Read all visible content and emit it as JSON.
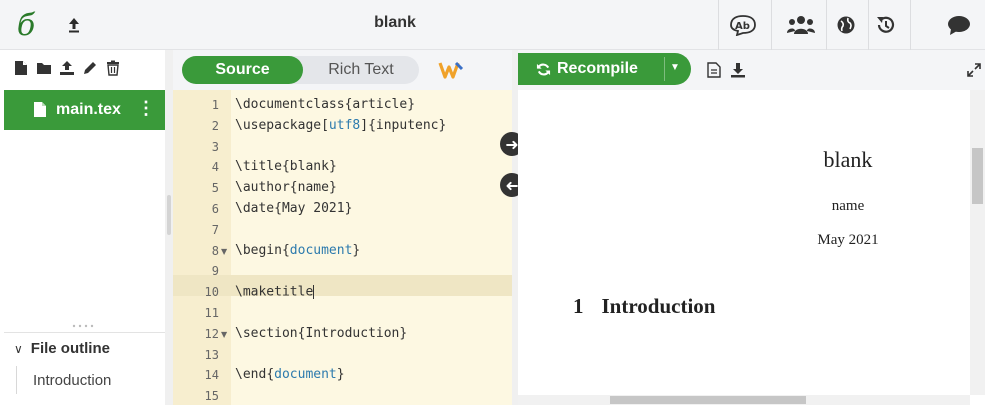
{
  "header": {
    "title": "blank",
    "logo_letter": "б",
    "up_icon": "upload-arrow-icon",
    "icons": [
      "review-icon",
      "share-icon",
      "history-globe-icon",
      "history-icon",
      "chat-icon"
    ]
  },
  "file_tree": {
    "toolbar_icons": [
      "new-file-icon",
      "new-folder-icon",
      "upload-icon",
      "rename-icon",
      "delete-icon"
    ],
    "items": [
      {
        "label": "main.tex"
      }
    ],
    "outline": {
      "title": "File outline",
      "items": [
        "Introduction"
      ]
    }
  },
  "editor": {
    "toggle": {
      "source": "Source",
      "rich_text": "Rich Text"
    },
    "active_line": 10,
    "lines": [
      {
        "n": "1",
        "text": "\\documentclass{article}"
      },
      {
        "n": "2",
        "text": "\\usepackage[utf8]{inputenc}"
      },
      {
        "n": "3",
        "text": ""
      },
      {
        "n": "4",
        "text": "\\title{blank}"
      },
      {
        "n": "5",
        "text": "\\author{name}"
      },
      {
        "n": "6",
        "text": "\\date{May 2021}"
      },
      {
        "n": "7",
        "text": ""
      },
      {
        "n": "8",
        "text": "\\begin{document}",
        "fold": true
      },
      {
        "n": "9",
        "text": ""
      },
      {
        "n": "10",
        "text": "\\maketitle"
      },
      {
        "n": "11",
        "text": ""
      },
      {
        "n": "12",
        "text": "\\section{Introduction}",
        "fold": true
      },
      {
        "n": "13",
        "text": ""
      },
      {
        "n": "14",
        "text": "\\end{document}"
      },
      {
        "n": "15",
        "text": ""
      }
    ]
  },
  "pdf": {
    "recompile_label": "Recompile",
    "document": {
      "title": "blank",
      "author": "name",
      "date": "May 2021",
      "section_number": "1",
      "section_title": "Introduction"
    }
  },
  "colors": {
    "brand_green": "#3a9a3a",
    "editor_bg": "#fdf8e2",
    "gutter_bg": "#f7eecf"
  }
}
